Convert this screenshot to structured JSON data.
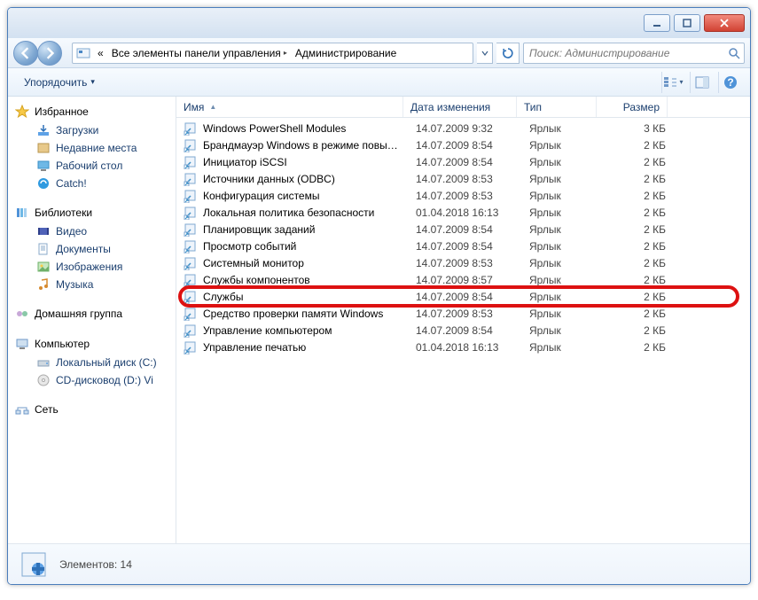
{
  "title_buttons": {
    "min": "min",
    "max": "max",
    "close": "close"
  },
  "breadcrumb": {
    "root_double_arrow": "«",
    "segments": [
      {
        "label": "Все элементы панели управления"
      },
      {
        "label": "Администрирование"
      }
    ]
  },
  "search": {
    "placeholder": "Поиск: Администрирование"
  },
  "toolbar": {
    "organize": "Упорядочить",
    "organize_arrow": "▾"
  },
  "columns": {
    "name": "Имя",
    "date": "Дата изменения",
    "type": "Тип",
    "size": "Размер"
  },
  "sidebar": {
    "favorites": {
      "label": "Избранное",
      "items": [
        "Загрузки",
        "Недавние места",
        "Рабочий стол",
        "Catch!"
      ]
    },
    "libraries": {
      "label": "Библиотеки",
      "items": [
        "Видео",
        "Документы",
        "Изображения",
        "Музыка"
      ]
    },
    "homegroup": {
      "label": "Домашняя группа"
    },
    "computer": {
      "label": "Компьютер",
      "items": [
        "Локальный диск (C:)",
        "CD-дисковод (D:) Vi"
      ]
    },
    "network": {
      "label": "Сеть"
    }
  },
  "rows": [
    {
      "name": "Windows PowerShell Modules",
      "date": "14.07.2009 9:32",
      "type": "Ярлык",
      "size": "3 КБ"
    },
    {
      "name": "Брандмауэр Windows в режиме повы…",
      "date": "14.07.2009 8:54",
      "type": "Ярлык",
      "size": "2 КБ"
    },
    {
      "name": "Инициатор iSCSI",
      "date": "14.07.2009 8:54",
      "type": "Ярлык",
      "size": "2 КБ"
    },
    {
      "name": "Источники данных (ODBC)",
      "date": "14.07.2009 8:53",
      "type": "Ярлык",
      "size": "2 КБ"
    },
    {
      "name": "Конфигурация системы",
      "date": "14.07.2009 8:53",
      "type": "Ярлык",
      "size": "2 КБ"
    },
    {
      "name": "Локальная политика безопасности",
      "date": "01.04.2018 16:13",
      "type": "Ярлык",
      "size": "2 КБ"
    },
    {
      "name": "Планировщик заданий",
      "date": "14.07.2009 8:54",
      "type": "Ярлык",
      "size": "2 КБ"
    },
    {
      "name": "Просмотр событий",
      "date": "14.07.2009 8:54",
      "type": "Ярлык",
      "size": "2 КБ"
    },
    {
      "name": "Системный монитор",
      "date": "14.07.2009 8:53",
      "type": "Ярлык",
      "size": "2 КБ"
    },
    {
      "name": "Службы компонентов",
      "date": "14.07.2009 8:57",
      "type": "Ярлык",
      "size": "2 КБ"
    },
    {
      "name": "Службы",
      "date": "14.07.2009 8:54",
      "type": "Ярлык",
      "size": "2 КБ"
    },
    {
      "name": "Средство проверки памяти Windows",
      "date": "14.07.2009 8:53",
      "type": "Ярлык",
      "size": "2 КБ"
    },
    {
      "name": "Управление компьютером",
      "date": "14.07.2009 8:54",
      "type": "Ярлык",
      "size": "2 КБ"
    },
    {
      "name": "Управление печатью",
      "date": "01.04.2018 16:13",
      "type": "Ярлык",
      "size": "2 КБ"
    }
  ],
  "highlighted_row_index": 10,
  "status": {
    "text": "Элементов: 14"
  }
}
